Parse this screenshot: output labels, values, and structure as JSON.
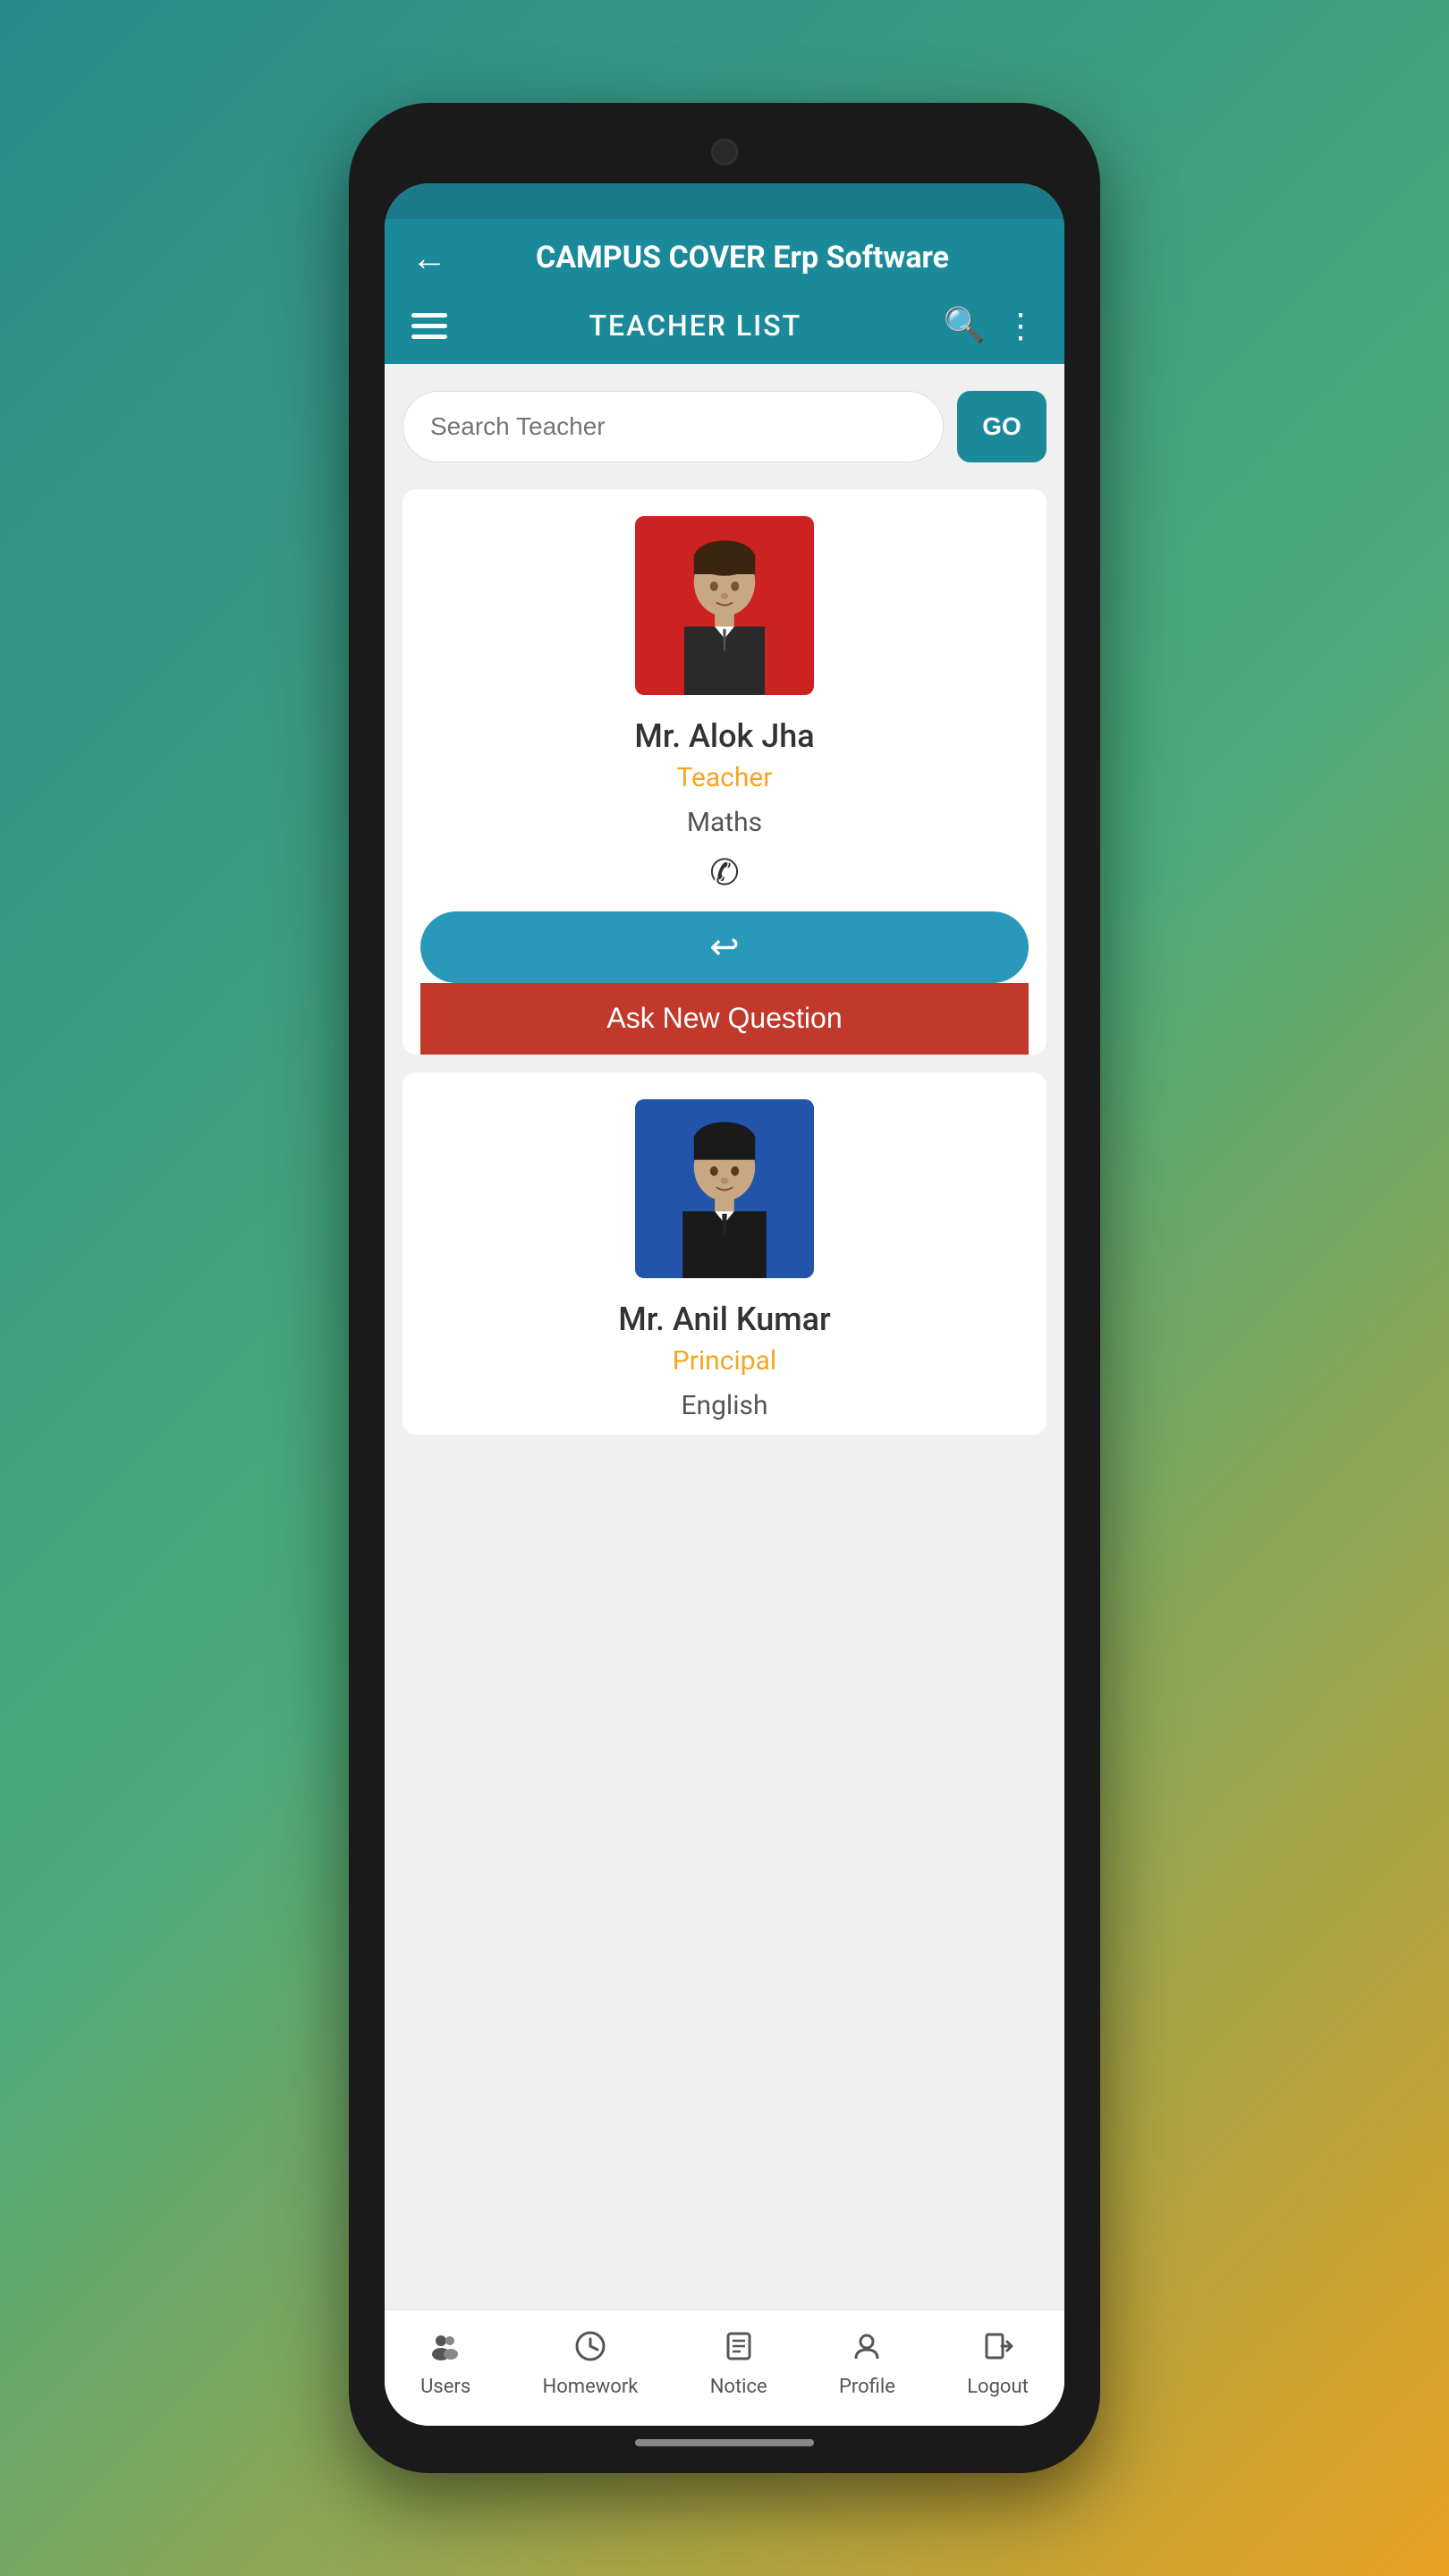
{
  "app": {
    "title": "CAMPUS COVER Erp Software",
    "toolbar_title": "TEACHER LIST"
  },
  "search": {
    "placeholder": "Search Teacher",
    "go_button": "GO"
  },
  "teachers": [
    {
      "id": "alok-jha",
      "name": "Mr. Alok Jha",
      "role": "Teacher",
      "subject": "Maths",
      "avatar_bg": "#cc2222"
    },
    {
      "id": "anil-kumar",
      "name": "Mr. Anil Kumar",
      "role": "Principal",
      "subject": "English",
      "avatar_bg": "#2255aa"
    }
  ],
  "buttons": {
    "ask_question": "Ask New Question",
    "reply_icon": "↩"
  },
  "bottom_nav": {
    "items": [
      {
        "id": "users",
        "label": "Users",
        "icon": "👥"
      },
      {
        "id": "homework",
        "label": "Homework",
        "icon": "🕐"
      },
      {
        "id": "notice",
        "label": "Notice",
        "icon": "📋"
      },
      {
        "id": "profile",
        "label": "Profile",
        "icon": "👤"
      },
      {
        "id": "logout",
        "label": "Logout",
        "icon": "🚪"
      }
    ]
  },
  "colors": {
    "primary": "#1a8a9a",
    "ask_question_bg": "#c0392b",
    "role_color": "#f5a623"
  }
}
